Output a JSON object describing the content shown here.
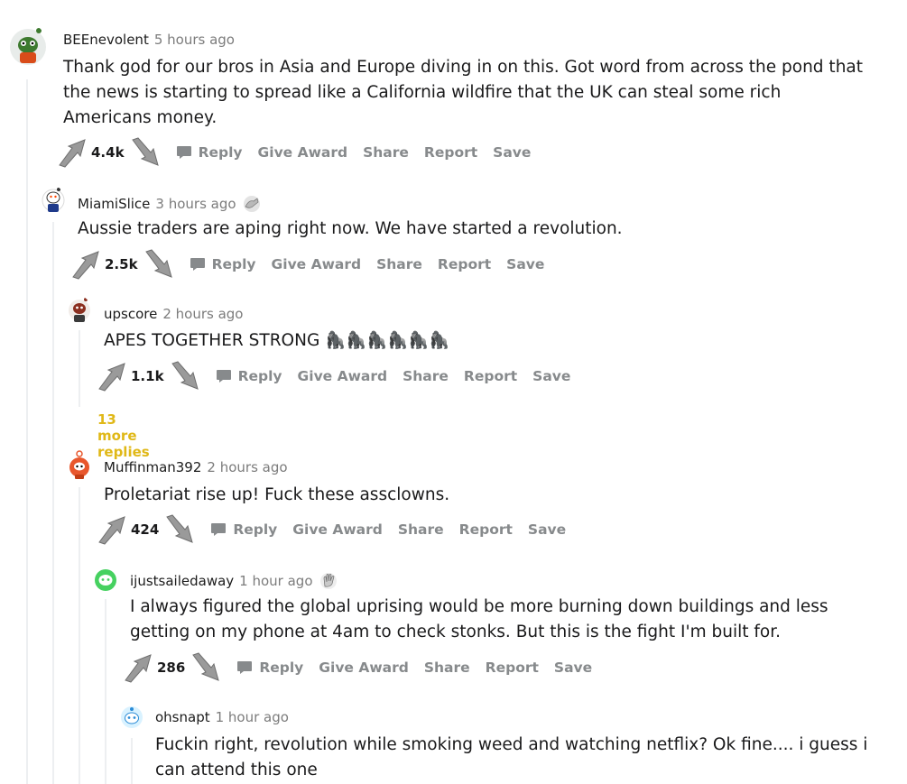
{
  "comments": [
    {
      "author": "BEEnevolent",
      "time": "5 hours ago",
      "body": "Thank god for our bros in Asia and Europe diving in on this. Got word from across the pond that the news is starting to spread like a California wildfire that the UK can steal some rich Americans money.",
      "score": "4.4k",
      "avatar_color": "#3d7a2f",
      "award_icon": null
    },
    {
      "author": "MiamiSlice",
      "time": "3 hours ago",
      "body": "Aussie traders are aping right now. We have started a revolution.",
      "score": "2.5k",
      "avatar_color": "#ffffff",
      "award_icon": "helping-hand-award-icon"
    },
    {
      "author": "upscore",
      "time": "2 hours ago",
      "body": "APES TOGETHER STRONG 🦍🦍🦍🦍🦍🦍",
      "score": "1.1k",
      "avatar_color": "#8b2f1f",
      "award_icon": null
    },
    {
      "author": "Muffinman392",
      "time": "2 hours ago",
      "body": "Proletariat rise up! Fuck these assclowns.",
      "score": "424",
      "avatar_color": "#e8572d",
      "award_icon": null
    },
    {
      "author": "ijustsailedaway",
      "time": "1 hour ago",
      "body": "I always figured the global uprising would be more burning down buildings and less getting on my phone at 4am to check stonks. But this is the fight I'm built for.",
      "score": "286",
      "avatar_color": "#46d160",
      "award_icon": "wholesome-award-icon"
    },
    {
      "author": "ohsnapt",
      "time": "1 hour ago",
      "body": "Fuckin right, revolution while smoking weed and watching netflix? Ok fine.... i guess i can attend this one",
      "avatar_color": "#0dd3bb"
    }
  ],
  "actions": {
    "reply": "Reply",
    "give_award": "Give Award",
    "share": "Share",
    "report": "Report",
    "save": "Save"
  },
  "more_replies": "13 more replies",
  "colors": {
    "action_gray": "#878a8c",
    "more_replies": "#e0b817",
    "thread_line": "#edeff1"
  }
}
